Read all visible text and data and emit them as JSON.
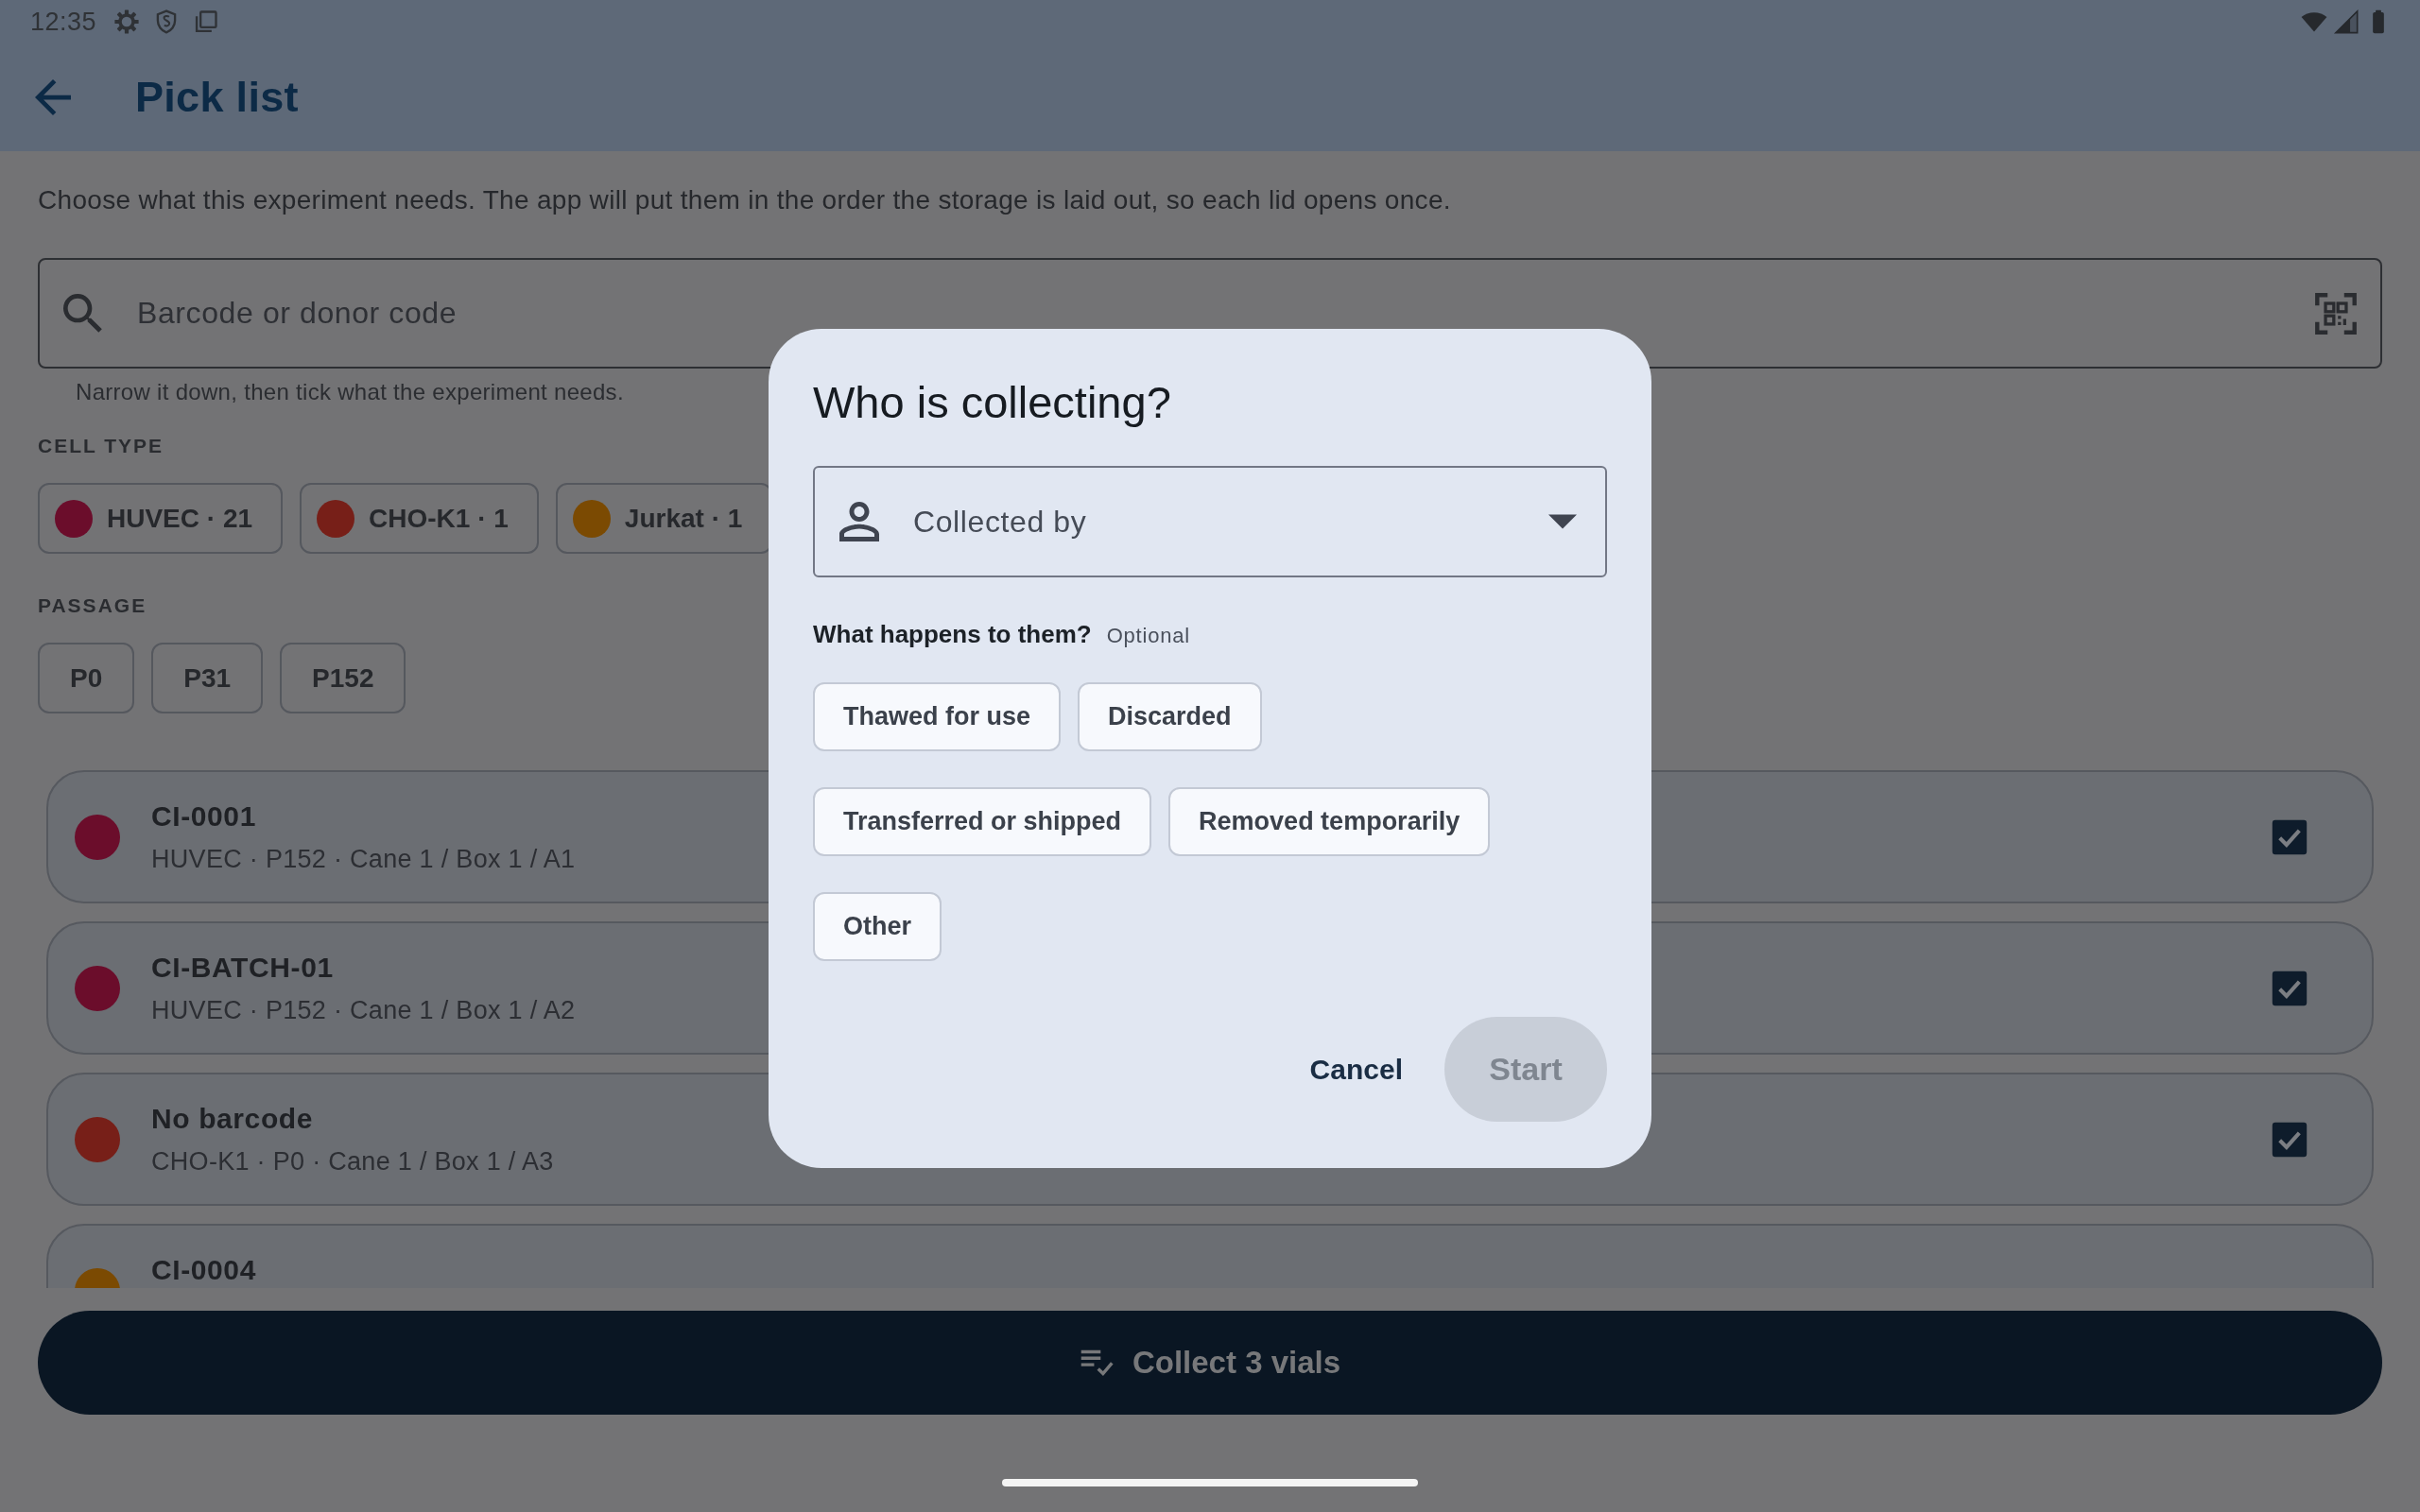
{
  "status_bar": {
    "time": "12:35"
  },
  "app_bar": {
    "title": "Pick list"
  },
  "intro": "Choose what this experiment needs. The app will put them in the order the storage is laid out, so each lid opens once.",
  "search": {
    "placeholder": "Barcode or donor code",
    "helper": "Narrow it down, then tick what the experiment needs."
  },
  "filters": [
    {
      "heading": "CELL TYPE",
      "chips": [
        {
          "label": "HUVEC · 21",
          "color": "#6b0d2b",
          "selected": false
        },
        {
          "label": "CHO-K1 · 1",
          "color": "#771f18",
          "selected": false
        },
        {
          "label": "Jurkat · 1",
          "color": "#7b4a02",
          "selected": false
        }
      ]
    },
    {
      "heading": "PASSAGE",
      "chips": [
        {
          "label": "P0",
          "selected": false
        },
        {
          "label": "P31",
          "selected": false
        },
        {
          "label": "P152",
          "selected": false
        }
      ]
    }
  ],
  "vials": [
    {
      "title": "CI-0001",
      "detail": "HUVEC · P152 · Cane 1 / Box 1 / A1",
      "color": "#6b0d2b",
      "checked": true
    },
    {
      "title": "CI-BATCH-01",
      "detail": "HUVEC · P152 · Cane 1 / Box 1 / A2",
      "color": "#6b0d2b",
      "checked": true
    },
    {
      "title": "No barcode",
      "detail": "CHO-K1 · P0 · Cane 1 / Box 1 / A3",
      "color": "#771f18",
      "checked": true
    },
    {
      "title": "CI-0004",
      "color": "#7b4a02"
    }
  ],
  "collect_button": {
    "label": "Collect 3 vials"
  },
  "dialog": {
    "title": "Who is collecting?",
    "collector_field": {
      "placeholder": "Collected by"
    },
    "question": "What happens to them?",
    "question_hint": "Optional",
    "outcomes": [
      {
        "label": "Thawed for use",
        "selected": false
      },
      {
        "label": "Discarded",
        "selected": false
      },
      {
        "label": "Transferred or shipped",
        "selected": false
      },
      {
        "label": "Removed temporarily",
        "selected": false
      },
      {
        "label": "Other",
        "selected": false
      }
    ],
    "cancel": "Cancel",
    "start": {
      "label": "Start",
      "disabled": true
    }
  }
}
